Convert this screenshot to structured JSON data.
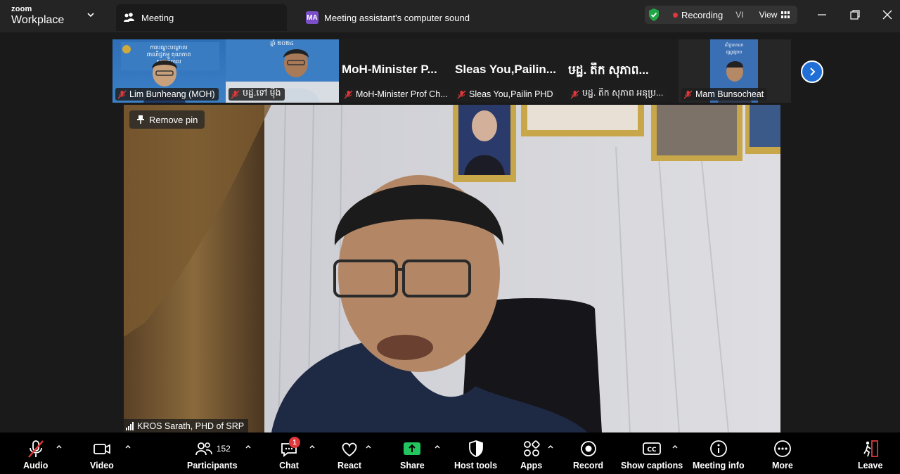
{
  "app": {
    "brand_top": "zoom",
    "brand_bottom": "Workplace"
  },
  "tabs": {
    "meeting": "Meeting",
    "assistant_badge": "MA",
    "assistant": "Meeting assistant's computer sound"
  },
  "status": {
    "recording": "Recording",
    "lang": "VI",
    "view": "View"
  },
  "thumbnails": [
    {
      "name": "Lim Bunheang (MOH)",
      "big": ""
    },
    {
      "name": "ឞដ្ឋ.ទៅ ម៉ឹង",
      "big": ""
    },
    {
      "name": "MoH-Minister Prof Ch...",
      "big": "MoH-Minister  P..."
    },
    {
      "name": "Sleas You,Pailin PHD",
      "big": "Sleas You,Pailin..."
    },
    {
      "name": "ឞដ្ឋ. តឹក សុភាព អនុប្រ...",
      "big": "ឞដ្ឋ. តឹក សុភាព..."
    },
    {
      "name": "Mam Bunsocheat",
      "big": ""
    }
  ],
  "main": {
    "remove_pin": "Remove pin",
    "speaker": "KROS Sarath, PHD of SRP"
  },
  "toolbar": {
    "audio": "Audio",
    "video": "Video",
    "participants": "Participants",
    "participants_count": "152",
    "chat": "Chat",
    "chat_badge": "1",
    "react": "React",
    "share": "Share",
    "host_tools": "Host tools",
    "apps": "Apps",
    "record": "Record",
    "captions": "Show captions",
    "meeting_info": "Meeting info",
    "more": "More",
    "leave": "Leave"
  },
  "colors": {
    "accent_blue": "#1f6fd6",
    "share_green": "#22c55e",
    "record_red": "#e0383a",
    "shield_green": "#22a546"
  }
}
